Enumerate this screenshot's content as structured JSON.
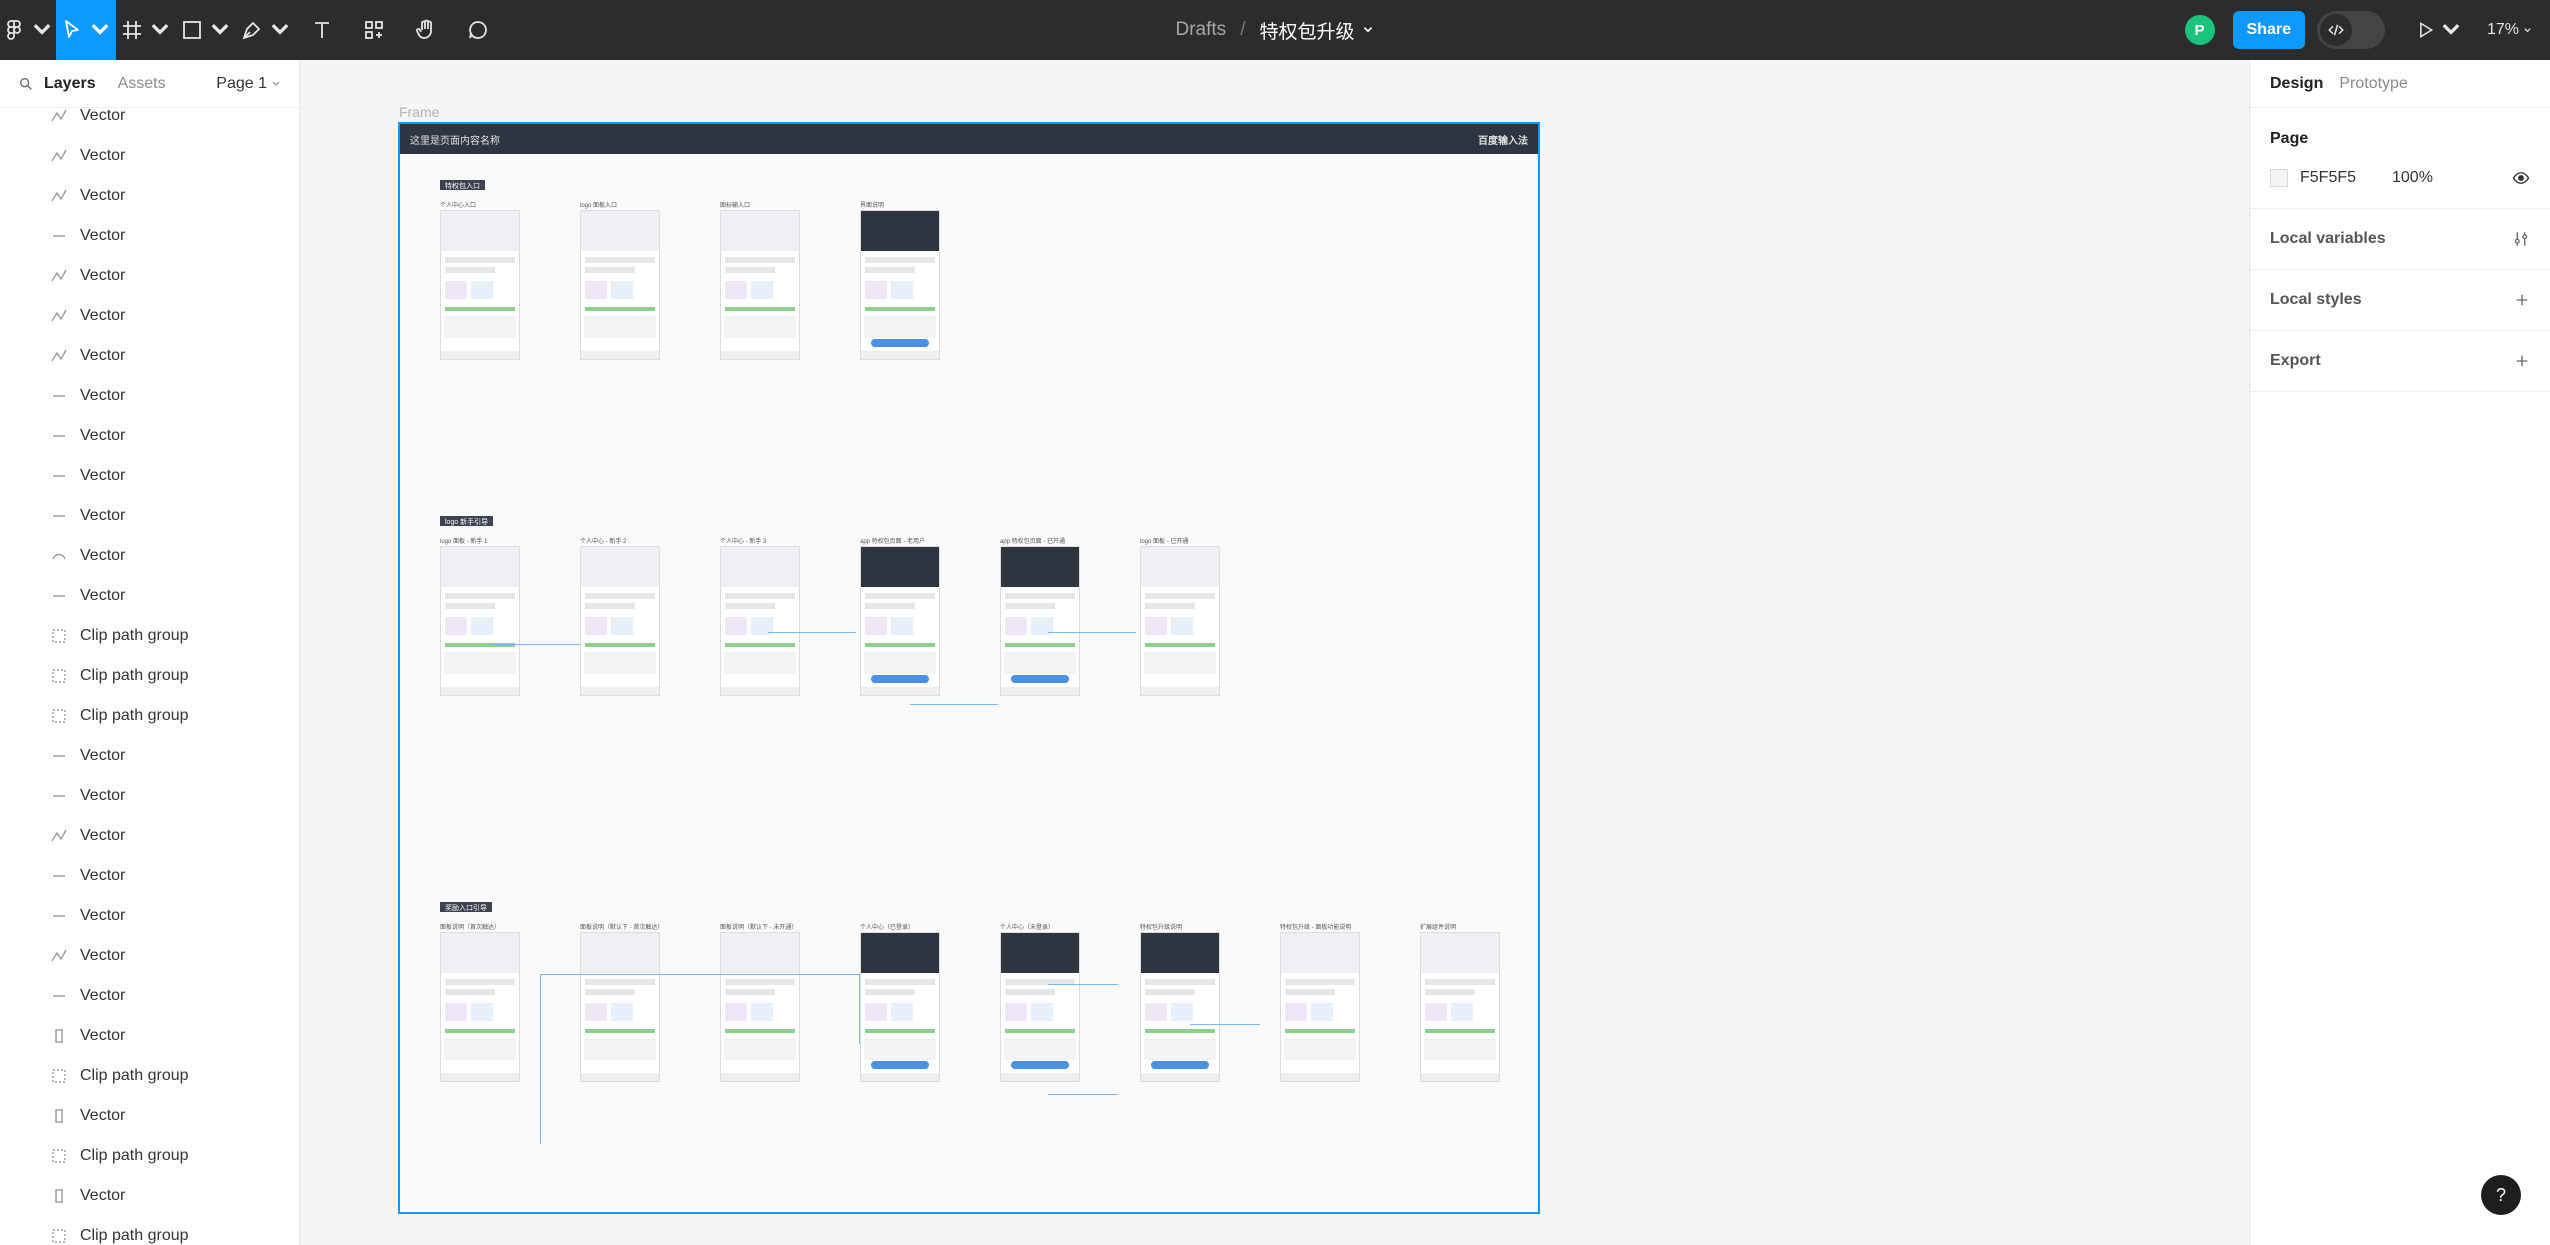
{
  "toolbar": {
    "breadcrumb_root": "Drafts",
    "breadcrumb_sep": "/",
    "file_name": "特权包升级",
    "share_label": "Share",
    "avatar_initial": "P",
    "zoom": "17%"
  },
  "left_panel": {
    "tab_layers": "Layers",
    "tab_assets": "Assets",
    "page": "Page 1",
    "layers": [
      {
        "name": "Vector",
        "icon": "vector-icon"
      },
      {
        "name": "Vector",
        "icon": "vector-icon"
      },
      {
        "name": "Vector",
        "icon": "vector-icon"
      },
      {
        "name": "Vector",
        "icon": "line-icon"
      },
      {
        "name": "Vector",
        "icon": "vector-icon"
      },
      {
        "name": "Vector",
        "icon": "vector-icon"
      },
      {
        "name": "Vector",
        "icon": "vector-icon"
      },
      {
        "name": "Vector",
        "icon": "line-icon"
      },
      {
        "name": "Vector",
        "icon": "line-icon"
      },
      {
        "name": "Vector",
        "icon": "line-icon"
      },
      {
        "name": "Vector",
        "icon": "line-icon"
      },
      {
        "name": "Vector",
        "icon": "curve-icon"
      },
      {
        "name": "Vector",
        "icon": "line-icon"
      },
      {
        "name": "Clip path group",
        "icon": "clip-group-icon"
      },
      {
        "name": "Clip path group",
        "icon": "clip-group-icon"
      },
      {
        "name": "Clip path group",
        "icon": "clip-group-icon"
      },
      {
        "name": "Vector",
        "icon": "line-icon"
      },
      {
        "name": "Vector",
        "icon": "line-icon"
      },
      {
        "name": "Vector",
        "icon": "vector-icon"
      },
      {
        "name": "Vector",
        "icon": "line-icon"
      },
      {
        "name": "Vector",
        "icon": "line-icon"
      },
      {
        "name": "Vector",
        "icon": "vector-icon"
      },
      {
        "name": "Vector",
        "icon": "line-icon"
      },
      {
        "name": "Vector",
        "icon": "rect-icon"
      },
      {
        "name": "Clip path group",
        "icon": "clip-group-icon"
      },
      {
        "name": "Vector",
        "icon": "rect-icon"
      },
      {
        "name": "Clip path group",
        "icon": "clip-group-icon"
      },
      {
        "name": "Vector",
        "icon": "rect-icon"
      },
      {
        "name": "Clip path group",
        "icon": "clip-group-icon"
      }
    ]
  },
  "canvas": {
    "frame_label": "Frame",
    "frame_topbar_title": "这里是页面内容名称",
    "frame_brand": "百度输入法",
    "sections": [
      "特权包入口",
      "logo 新手引导",
      "奖励入口引导"
    ],
    "row1": [
      "个人中心入口",
      "logo 面板入口",
      "图标输入口",
      "界面说明"
    ],
    "row2": [
      "logo 面板 - 新手 1",
      "个人中心 - 新手 2",
      "个人中心 - 新手 3",
      "app 特权包页面 - 老用户",
      "app 特权包页面 - 已开通",
      "logo 面板 - 已开通"
    ],
    "row3": [
      "面板说明（首次触达）",
      "面板说明（默认下 - 首次触达）",
      "面板说明（默认下 - 未开通）",
      "个人中心（已登录）",
      "个人中心（未登录）",
      "特权包升级说明",
      "特权包升级 - 面板功能说明",
      "扩展组件说明"
    ]
  },
  "right_panel": {
    "tab_design": "Design",
    "tab_prototype": "Prototype",
    "page_title": "Page",
    "page_color": "F5F5F5",
    "page_opacity": "100%",
    "local_variables": "Local variables",
    "local_styles": "Local styles",
    "export": "Export"
  },
  "help_label": "?"
}
